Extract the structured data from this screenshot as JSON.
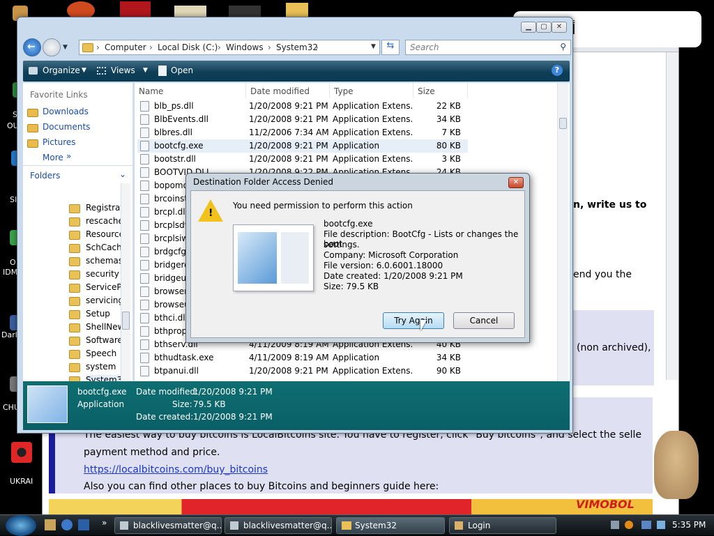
{
  "desktop_labels": [
    "S",
    "OU",
    "SI",
    "O",
    "IDM",
    "Dark",
    "CHU",
    "UKRAI"
  ],
  "browser_bg": {
    "arabic_text": "أ",
    "line1": "n, write us to",
    "line2": "end you the",
    "line3": "(non archived),",
    "para1": "The easiest way to buy bitcoins is LocalBitcoins site. You have to register, click \"Buy bitcoins\", and select the seller by",
    "para2": "payment method and price.",
    "link": "https://localbitcoins.com/buy_bitcoins",
    "para3": "Also you can find other places to buy Bitcoins and beginners guide here:",
    "banner": "VIMOBOL"
  },
  "explorer": {
    "address": [
      "Computer",
      "Local Disk (C:)",
      "Windows",
      "System32"
    ],
    "search_placeholder": "Search",
    "toolbar": {
      "organize": "Organize",
      "views": "Views",
      "open": "Open",
      "help": "?"
    },
    "favorite_links_label": "Favorite Links",
    "favorites": [
      "Downloads",
      "Documents",
      "Pictures"
    ],
    "more": "More",
    "folders_label": "Folders",
    "tree": [
      "Registratio",
      "rescache",
      "Resources",
      "SchCache",
      "schemas",
      "security",
      "ServiceProf",
      "servicing",
      "Setup",
      "ShellNew",
      "SoftwareDi",
      "Speech",
      "system",
      "System32",
      "tapi"
    ],
    "columns": [
      "Name",
      "Date modified",
      "Type",
      "Size"
    ],
    "files": [
      {
        "name": "blb_ps.dll",
        "date": "1/20/2008 9:21 PM",
        "type": "Application Extens...",
        "size": "22 KB"
      },
      {
        "name": "BlbEvents.dll",
        "date": "1/20/2008 9:21 PM",
        "type": "Application Extens...",
        "size": "34 KB"
      },
      {
        "name": "blbres.dll",
        "date": "11/2/2006 7:34 AM",
        "type": "Application Extens...",
        "size": "7 KB"
      },
      {
        "name": "bootcfg.exe",
        "date": "1/20/2008 9:21 PM",
        "type": "Application",
        "size": "80 KB"
      },
      {
        "name": "bootstr.dll",
        "date": "1/20/2008 9:21 PM",
        "type": "Application Extens...",
        "size": "3 KB"
      },
      {
        "name": "BOOTVID.DLL",
        "date": "1/20/2008 9:22 PM",
        "type": "Application Extens...",
        "size": "24 KB"
      },
      {
        "name": "bopomofo",
        "date": "",
        "type": "",
        "size": ""
      },
      {
        "name": "brcoinst",
        "date": "",
        "type": "",
        "size": ""
      },
      {
        "name": "brcpl.dll",
        "date": "",
        "type": "",
        "size": ""
      },
      {
        "name": "brcplsdw",
        "date": "",
        "type": "",
        "size": ""
      },
      {
        "name": "brcplsiw",
        "date": "",
        "type": "",
        "size": ""
      },
      {
        "name": "brdgcfg",
        "date": "",
        "type": "",
        "size": ""
      },
      {
        "name": "bridgeres",
        "date": "",
        "type": "",
        "size": ""
      },
      {
        "name": "bridgeun",
        "date": "",
        "type": "",
        "size": ""
      },
      {
        "name": "browser",
        "date": "",
        "type": "",
        "size": ""
      },
      {
        "name": "browseui",
        "date": "",
        "type": "",
        "size": ""
      },
      {
        "name": "bthci.dll",
        "date": "",
        "type": "",
        "size": ""
      },
      {
        "name": "bthprops",
        "date": "",
        "type": "",
        "size": ""
      },
      {
        "name": "bthserv.dll",
        "date": "4/11/2009 8:19 AM",
        "type": "Application Extens...",
        "size": "40 KB"
      },
      {
        "name": "bthudtask.exe",
        "date": "4/11/2009 8:19 AM",
        "type": "Application",
        "size": "34 KB"
      },
      {
        "name": "btpanui.dll",
        "date": "1/20/2008 9:21 PM",
        "type": "Application Extens...",
        "size": "90 KB"
      }
    ],
    "details": {
      "filename": "bootcfg.exe",
      "type": "Application",
      "date_modified_label": "Date modified:",
      "date_modified": "1/20/2008 9:21 PM",
      "size_label": "Size:",
      "size": "79.5 KB",
      "date_created_label": "Date created:",
      "date_created": "1/20/2008 9:21 PM"
    }
  },
  "dialog": {
    "title": "Destination Folder Access Denied",
    "message": "You need permission to perform this action",
    "file_name": "bootcfg.exe",
    "description_line1": "File description: BootCfg - Lists or changes the boot",
    "description_line2": "settings.",
    "company": "Company: Microsoft Corporation",
    "version": "File version: 6.0.6001.18000",
    "created": "Date created: 1/20/2008 9:21 PM",
    "size": "Size: 79.5 KB",
    "try_again": "Try Again",
    "cancel": "Cancel"
  },
  "taskbar": {
    "tasks": [
      "blacklivesmatter@q...",
      "blacklivesmatter@q...",
      "System32",
      "Login"
    ],
    "clock": "5:35 PM",
    "chevron": "»"
  }
}
